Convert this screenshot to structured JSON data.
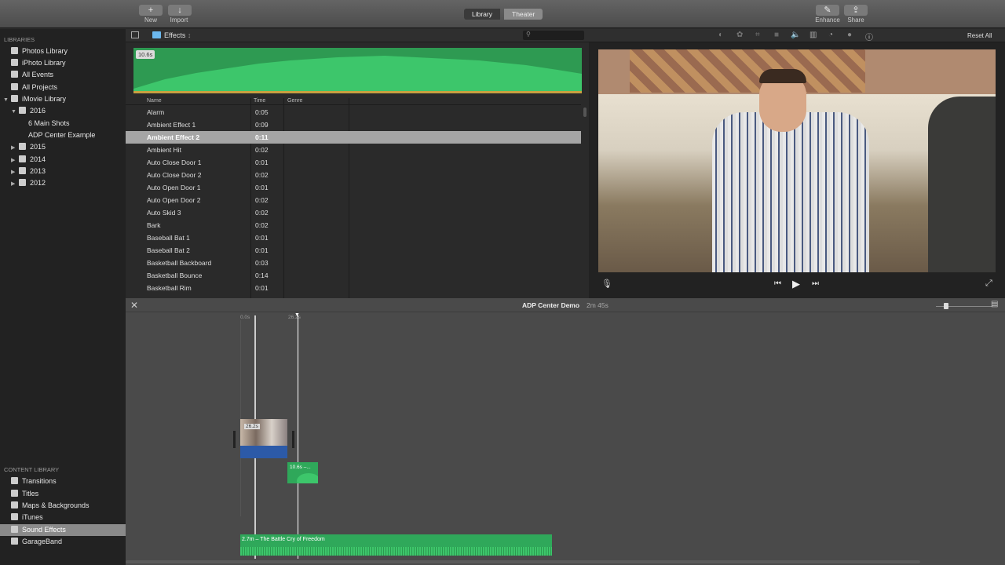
{
  "toolbar": {
    "new_label": "New",
    "import_label": "Import",
    "library_tab": "Library",
    "theater_tab": "Theater",
    "enhance_label": "Enhance",
    "share_label": "Share"
  },
  "sidebar": {
    "libraries_header": "LIBRARIES",
    "libraries": [
      {
        "label": "Photos Library"
      },
      {
        "label": "iPhoto Library"
      },
      {
        "label": "All Events"
      },
      {
        "label": "All Projects"
      },
      {
        "label": "iMovie Library"
      },
      {
        "label": "2016"
      },
      {
        "label": "6 Main Shots"
      },
      {
        "label": "ADP Center Example"
      },
      {
        "label": "2015"
      },
      {
        "label": "2014"
      },
      {
        "label": "2013"
      },
      {
        "label": "2012"
      }
    ],
    "content_header": "CONTENT LIBRARY",
    "content": [
      {
        "label": "Transitions"
      },
      {
        "label": "Titles"
      },
      {
        "label": "Maps & Backgrounds"
      },
      {
        "label": "iTunes"
      },
      {
        "label": "Sound Effects"
      },
      {
        "label": "GarageBand"
      }
    ]
  },
  "browser": {
    "folder": "Effects",
    "waveform_duration": "10.6s",
    "columns": {
      "name": "Name",
      "time": "Time",
      "genre": "Genre"
    },
    "rows": [
      {
        "name": "Alarm",
        "time": "0:05"
      },
      {
        "name": "Ambient Effect 1",
        "time": "0:09"
      },
      {
        "name": "Ambient Effect 2",
        "time": "0:11"
      },
      {
        "name": "Ambient Hit",
        "time": "0:02"
      },
      {
        "name": "Auto Close Door 1",
        "time": "0:01"
      },
      {
        "name": "Auto Close Door 2",
        "time": "0:02"
      },
      {
        "name": "Auto Open Door 1",
        "time": "0:01"
      },
      {
        "name": "Auto Open Door 2",
        "time": "0:02"
      },
      {
        "name": "Auto Skid 3",
        "time": "0:02"
      },
      {
        "name": "Bark",
        "time": "0:02"
      },
      {
        "name": "Baseball Bat 1",
        "time": "0:01"
      },
      {
        "name": "Baseball Bat 2",
        "time": "0:01"
      },
      {
        "name": "Basketball Backboard",
        "time": "0:03"
      },
      {
        "name": "Basketball Bounce",
        "time": "0:14"
      },
      {
        "name": "Basketball Rim",
        "time": "0:01"
      }
    ],
    "selected_index": 2
  },
  "viewer": {
    "reset_all": "Reset All"
  },
  "timeline": {
    "project_title": "ADP Center Demo",
    "project_duration": "2m 45s",
    "ruler_start": "0.0s",
    "ruler_playhead": "26.2s",
    "video_clip_duration": "26.2s",
    "sfx_clip_label": "10.6s –...",
    "music_clip_label": "2.7m – The Battle Cry of Freedom"
  },
  "colors": {
    "audio_green": "#3cbf63",
    "video_blue": "#2c5aa8",
    "selection": "#a5a5a5"
  }
}
